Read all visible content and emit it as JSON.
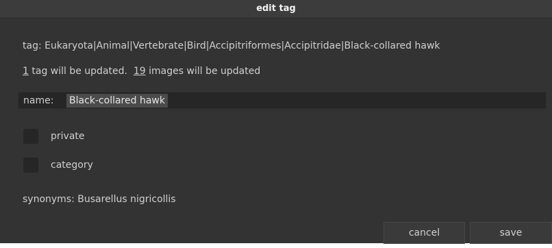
{
  "dialog": {
    "title": "edit tag",
    "tag_path": "tag: Eukaryota|Animal|Vertebrate|Bird|Accipitriformes|Accipitridae|Black-collared hawk",
    "counts": {
      "tags_number": "1",
      "tags_text": " tag will be updated.  ",
      "images_number": "19",
      "images_text": " images will be updated"
    },
    "name": {
      "label": "name:",
      "value": "Black-collared hawk"
    },
    "private": {
      "label": "private",
      "checked": false
    },
    "category": {
      "label": "category",
      "checked": false
    },
    "synonyms": "synonyms: Busarellus nigricollis",
    "buttons": {
      "cancel": "cancel",
      "save": "save"
    }
  }
}
